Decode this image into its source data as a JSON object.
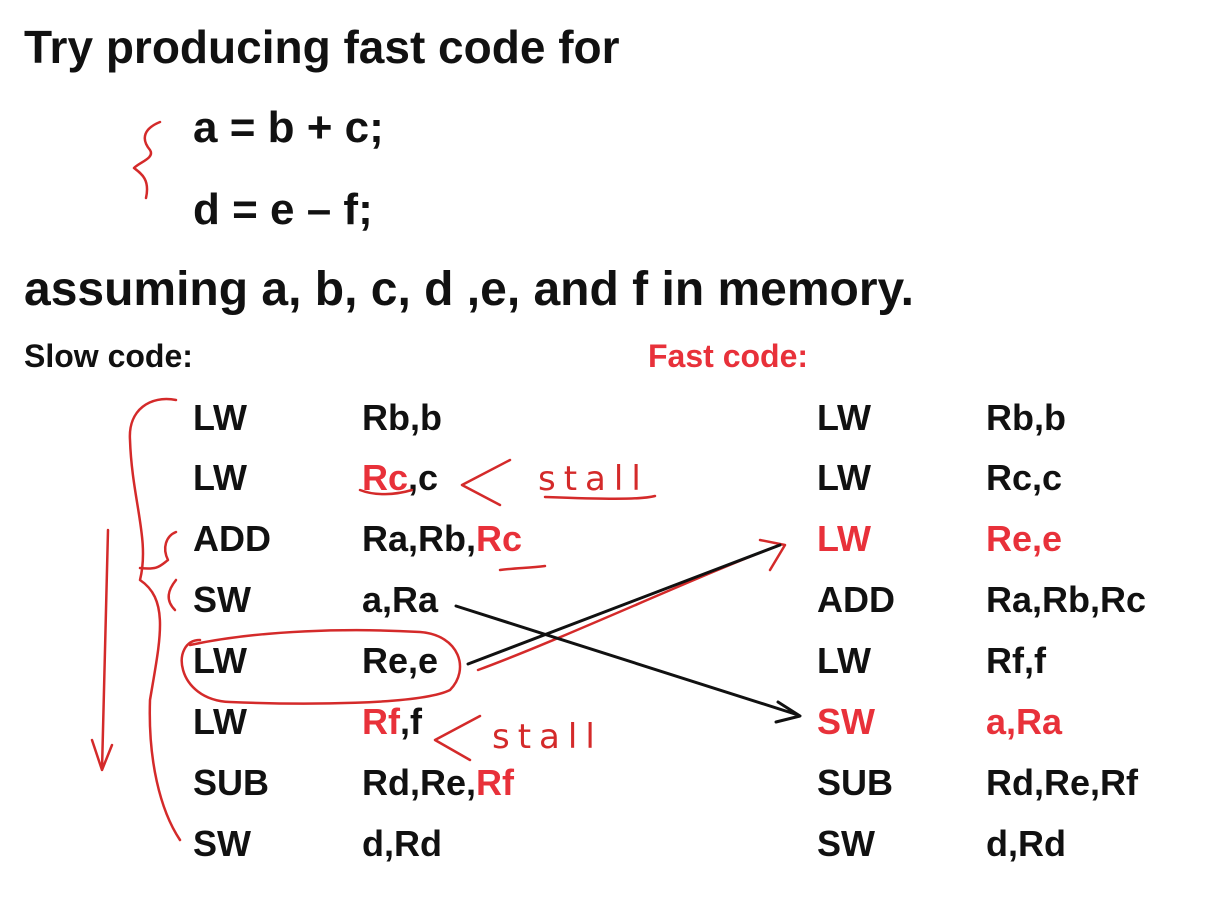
{
  "title": "Try producing fast code for",
  "equations": [
    "a = b + c;",
    "d = e – f;"
  ],
  "assumption": "assuming a, b, c, d ,e, and f in memory.",
  "slow_label": "Slow code:",
  "fast_label": "Fast code:",
  "colors": {
    "accent": "#e8313a",
    "ink": "#d42a2a",
    "text": "#111111"
  },
  "slow_code": [
    {
      "op": "LW",
      "args": [
        {
          "t": "Rb,b"
        }
      ]
    },
    {
      "op": "LW",
      "args": [
        {
          "t": "Rc",
          "red": true
        },
        {
          "t": ",c"
        }
      ]
    },
    {
      "op": "ADD",
      "args": [
        {
          "t": "Ra,Rb,"
        },
        {
          "t": "Rc",
          "red": true
        }
      ]
    },
    {
      "op": "SW",
      "args": [
        {
          "t": "a,Ra"
        }
      ]
    },
    {
      "op": "LW",
      "args": [
        {
          "t": "Re,e"
        }
      ]
    },
    {
      "op": "LW",
      "args": [
        {
          "t": "Rf",
          "red": true
        },
        {
          "t": ",f"
        }
      ]
    },
    {
      "op": "SUB",
      "args": [
        {
          "t": "Rd,Re,"
        },
        {
          "t": "Rf",
          "red": true
        }
      ]
    },
    {
      "op": "SW",
      "args": [
        {
          "t": "d,Rd"
        }
      ]
    }
  ],
  "fast_code": [
    {
      "op": "LW",
      "args": [
        {
          "t": "Rb,b"
        }
      ]
    },
    {
      "op": "LW",
      "args": [
        {
          "t": "Rc,c"
        }
      ]
    },
    {
      "op": "LW",
      "red": true,
      "args": [
        {
          "t": "Re,e",
          "red": true
        }
      ]
    },
    {
      "op": "ADD",
      "args": [
        {
          "t": "Ra,Rb,Rc"
        }
      ]
    },
    {
      "op": "LW",
      "args": [
        {
          "t": "Rf,f"
        }
      ]
    },
    {
      "op": "SW",
      "red": true,
      "args": [
        {
          "t": "a,Ra",
          "red": true
        }
      ]
    },
    {
      "op": "SUB",
      "args": [
        {
          "t": "Rd,Re,Rf"
        }
      ]
    },
    {
      "op": "SW",
      "args": [
        {
          "t": "d,Rd"
        }
      ]
    }
  ],
  "annotations": [
    "stall",
    "stall"
  ]
}
